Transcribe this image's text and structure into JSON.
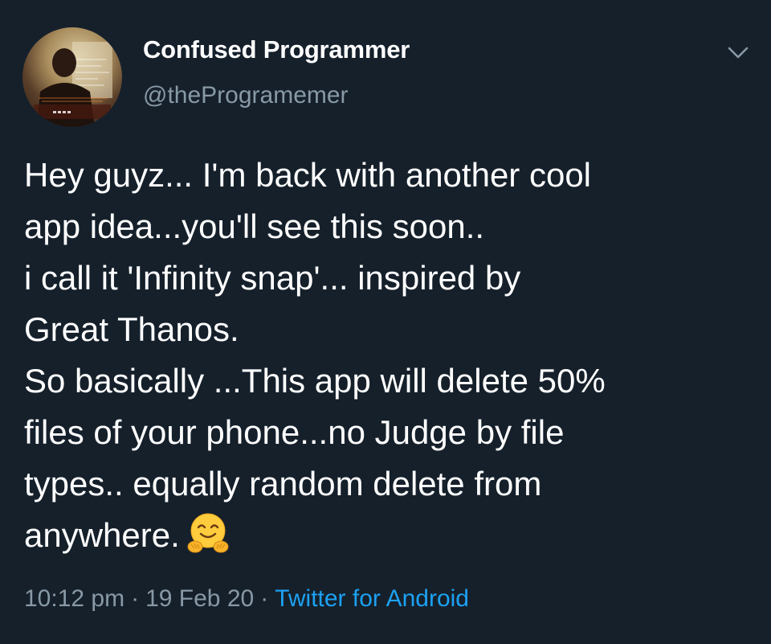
{
  "author": {
    "name": "Confused Programmer",
    "handle": "@theProgramemer"
  },
  "tweet": {
    "lines": [
      "Hey guyz... I'm back with another cool",
      "app idea...you'll see this soon..",
      "i call it 'Infinity snap'... inspired by",
      "Great Thanos.",
      "So basically ...This app will delete 50%",
      "files of your phone...no Judge by file",
      "types.. equally random delete from",
      "anywhere."
    ],
    "emoji": "hugging-face-emoji"
  },
  "meta": {
    "time": "10:12 pm",
    "date": "19 Feb 20",
    "source": "Twitter for Android",
    "separator": "·"
  },
  "icons": {
    "menu": "chevron-down-icon"
  },
  "colors": {
    "background": "#15202b",
    "text": "#ffffff",
    "secondary": "#8899a6",
    "accent": "#1da1f2"
  }
}
